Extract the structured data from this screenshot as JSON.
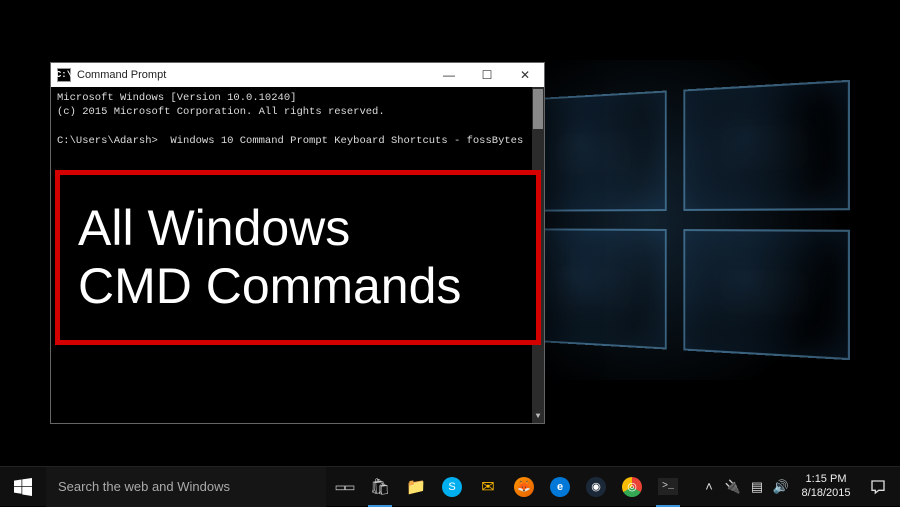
{
  "desktop": {
    "logo_panes": 4
  },
  "cmd": {
    "title": "Command Prompt",
    "icon_text": "C:\\",
    "lines": {
      "l1": "Microsoft Windows [Version 10.0.10240]",
      "l2": "(c) 2015 Microsoft Corporation. All rights reserved.",
      "l3": "",
      "l4": "C:\\Users\\Adarsh>  Windows 10 Command Prompt Keyboard Shortcuts - fossBytes"
    },
    "controls": {
      "min": "—",
      "max": "☐",
      "close": "✕"
    }
  },
  "overlay": {
    "headline": "All Windows\nCMD Commands"
  },
  "taskbar": {
    "search_placeholder": "Search the web and Windows",
    "icons": {
      "taskview": "▭▭",
      "store": "🛍",
      "explorer": "📁",
      "skype": "S",
      "mail": "✉",
      "firefox": "🦊",
      "edge": "e",
      "steam": "◉",
      "chrome": "◎",
      "terminal": ">_"
    },
    "tray": {
      "chevron": "˄",
      "power": "🔌",
      "network": "▤",
      "volume": "🔊"
    },
    "clock": {
      "time": "1:15 PM",
      "date": "8/18/2015"
    }
  }
}
